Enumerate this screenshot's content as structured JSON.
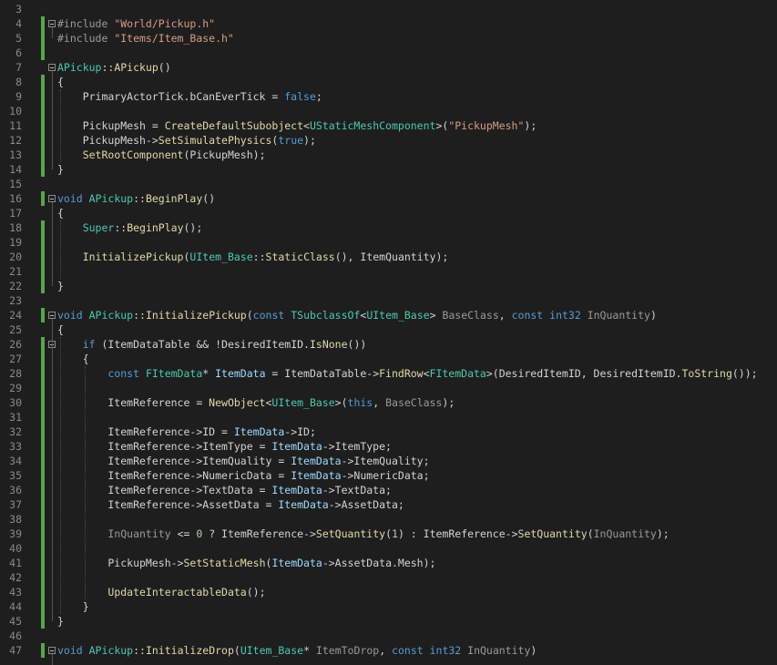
{
  "colors": {
    "background": "#1e1e1e",
    "keyword": "#569cd6",
    "string": "#d69d85",
    "type": "#4ec9b0",
    "function": "#dcdcaa",
    "variable": "#9cdcfe",
    "number": "#b5cea8",
    "change_bar": "#57a64a"
  },
  "lines": [
    {
      "num": "3",
      "tokens": []
    },
    {
      "num": "4",
      "tokens": [
        [
          "pre",
          "#include "
        ],
        [
          "str",
          "\"World/Pickup.h\""
        ]
      ]
    },
    {
      "num": "5",
      "tokens": [
        [
          "pre",
          "#include "
        ],
        [
          "str",
          "\"Items/Item_Base.h\""
        ]
      ]
    },
    {
      "num": "6",
      "tokens": []
    },
    {
      "num": "7",
      "tokens": [
        [
          "cls",
          "APickup"
        ],
        [
          "def",
          "::"
        ],
        [
          "fn",
          "APickup"
        ],
        [
          "def",
          "()"
        ]
      ]
    },
    {
      "num": "8",
      "tokens": [
        [
          "def",
          "{"
        ]
      ]
    },
    {
      "num": "9",
      "tokens": [
        [
          "def",
          "    PrimaryActorTick.bCanEverTick = "
        ],
        [
          "kw",
          "false"
        ],
        [
          "def",
          ";"
        ]
      ]
    },
    {
      "num": "10",
      "tokens": []
    },
    {
      "num": "11",
      "tokens": [
        [
          "def",
          "    PickupMesh = "
        ],
        [
          "fn",
          "CreateDefaultSubobject"
        ],
        [
          "def",
          "<"
        ],
        [
          "cls",
          "UStaticMeshComponent"
        ],
        [
          "def",
          ">("
        ],
        [
          "str",
          "\"PickupMesh\""
        ],
        [
          "def",
          ");"
        ]
      ]
    },
    {
      "num": "12",
      "tokens": [
        [
          "def",
          "    PickupMesh->"
        ],
        [
          "fn",
          "SetSimulatePhysics"
        ],
        [
          "def",
          "("
        ],
        [
          "kw",
          "true"
        ],
        [
          "def",
          ");"
        ]
      ]
    },
    {
      "num": "13",
      "tokens": [
        [
          "def",
          "    "
        ],
        [
          "fn",
          "SetRootComponent"
        ],
        [
          "def",
          "(PickupMesh);"
        ]
      ]
    },
    {
      "num": "14",
      "tokens": [
        [
          "def",
          "}"
        ]
      ]
    },
    {
      "num": "15",
      "tokens": []
    },
    {
      "num": "16",
      "tokens": [
        [
          "kw",
          "void "
        ],
        [
          "cls",
          "APickup"
        ],
        [
          "def",
          "::"
        ],
        [
          "fn",
          "BeginPlay"
        ],
        [
          "def",
          "()"
        ]
      ]
    },
    {
      "num": "17",
      "tokens": [
        [
          "def",
          "{"
        ]
      ]
    },
    {
      "num": "18",
      "tokens": [
        [
          "def",
          "    "
        ],
        [
          "cls",
          "Super"
        ],
        [
          "def",
          "::"
        ],
        [
          "fn",
          "BeginPlay"
        ],
        [
          "def",
          "();"
        ]
      ]
    },
    {
      "num": "19",
      "tokens": []
    },
    {
      "num": "20",
      "tokens": [
        [
          "def",
          "    "
        ],
        [
          "fn",
          "InitializePickup"
        ],
        [
          "def",
          "("
        ],
        [
          "cls",
          "UItem_Base"
        ],
        [
          "def",
          "::"
        ],
        [
          "fn",
          "StaticClass"
        ],
        [
          "def",
          "(), ItemQuantity);"
        ]
      ]
    },
    {
      "num": "21",
      "tokens": []
    },
    {
      "num": "22",
      "tokens": [
        [
          "def",
          "}"
        ]
      ]
    },
    {
      "num": "23",
      "tokens": []
    },
    {
      "num": "24",
      "tokens": [
        [
          "kw",
          "void "
        ],
        [
          "cls",
          "APickup"
        ],
        [
          "def",
          "::"
        ],
        [
          "fn",
          "InitializePickup"
        ],
        [
          "def",
          "("
        ],
        [
          "kw",
          "const "
        ],
        [
          "cls",
          "TSubclassOf"
        ],
        [
          "def",
          "<"
        ],
        [
          "cls",
          "UItem_Base"
        ],
        [
          "def",
          "> "
        ],
        [
          "par",
          "BaseClass"
        ],
        [
          "def",
          ", "
        ],
        [
          "kw",
          "const "
        ],
        [
          "kw",
          "int32 "
        ],
        [
          "par",
          "InQuantity"
        ],
        [
          "def",
          ")"
        ]
      ]
    },
    {
      "num": "25",
      "tokens": [
        [
          "def",
          "{"
        ]
      ]
    },
    {
      "num": "26",
      "tokens": [
        [
          "def",
          "    "
        ],
        [
          "kw",
          "if"
        ],
        [
          "def",
          " (ItemDataTable && !DesiredItemID."
        ],
        [
          "fn",
          "IsNone"
        ],
        [
          "def",
          "())"
        ]
      ]
    },
    {
      "num": "27",
      "tokens": [
        [
          "def",
          "    {"
        ]
      ]
    },
    {
      "num": "28",
      "tokens": [
        [
          "def",
          "        "
        ],
        [
          "kw",
          "const "
        ],
        [
          "cls",
          "FItemData"
        ],
        [
          "def",
          "* "
        ],
        [
          "var",
          "ItemData"
        ],
        [
          "def",
          " = ItemDataTable->"
        ],
        [
          "fn",
          "FindRow"
        ],
        [
          "def",
          "<"
        ],
        [
          "cls",
          "FItemData"
        ],
        [
          "def",
          ">(DesiredItemID, DesiredItemID."
        ],
        [
          "fn",
          "ToString"
        ],
        [
          "def",
          "());"
        ]
      ]
    },
    {
      "num": "29",
      "tokens": []
    },
    {
      "num": "30",
      "tokens": [
        [
          "def",
          "        ItemReference = "
        ],
        [
          "fn",
          "NewObject"
        ],
        [
          "def",
          "<"
        ],
        [
          "cls",
          "UItem_Base"
        ],
        [
          "def",
          ">("
        ],
        [
          "kw",
          "this"
        ],
        [
          "def",
          ", "
        ],
        [
          "par",
          "BaseClass"
        ],
        [
          "def",
          ");"
        ]
      ]
    },
    {
      "num": "31",
      "tokens": []
    },
    {
      "num": "32",
      "tokens": [
        [
          "def",
          "        ItemReference->ID = "
        ],
        [
          "var",
          "ItemData"
        ],
        [
          "def",
          "->ID;"
        ]
      ]
    },
    {
      "num": "33",
      "tokens": [
        [
          "def",
          "        ItemReference->ItemType = "
        ],
        [
          "var",
          "ItemData"
        ],
        [
          "def",
          "->ItemType;"
        ]
      ]
    },
    {
      "num": "34",
      "tokens": [
        [
          "def",
          "        ItemReference->ItemQuality = "
        ],
        [
          "var",
          "ItemData"
        ],
        [
          "def",
          "->ItemQuality;"
        ]
      ]
    },
    {
      "num": "35",
      "tokens": [
        [
          "def",
          "        ItemReference->NumericData = "
        ],
        [
          "var",
          "ItemData"
        ],
        [
          "def",
          "->NumericData;"
        ]
      ]
    },
    {
      "num": "36",
      "tokens": [
        [
          "def",
          "        ItemReference->TextData = "
        ],
        [
          "var",
          "ItemData"
        ],
        [
          "def",
          "->TextData;"
        ]
      ]
    },
    {
      "num": "37",
      "tokens": [
        [
          "def",
          "        ItemReference->AssetData = "
        ],
        [
          "var",
          "ItemData"
        ],
        [
          "def",
          "->AssetData;"
        ]
      ]
    },
    {
      "num": "38",
      "tokens": []
    },
    {
      "num": "39",
      "tokens": [
        [
          "def",
          "        "
        ],
        [
          "par",
          "InQuantity"
        ],
        [
          "def",
          " <= "
        ],
        [
          "num",
          "0"
        ],
        [
          "def",
          " ? ItemReference->"
        ],
        [
          "fn",
          "SetQuantity"
        ],
        [
          "def",
          "("
        ],
        [
          "num",
          "1"
        ],
        [
          "def",
          ") : ItemReference->"
        ],
        [
          "fn",
          "SetQuantity"
        ],
        [
          "def",
          "("
        ],
        [
          "par",
          "InQuantity"
        ],
        [
          "def",
          ");"
        ]
      ]
    },
    {
      "num": "40",
      "tokens": []
    },
    {
      "num": "41",
      "tokens": [
        [
          "def",
          "        PickupMesh->"
        ],
        [
          "fn",
          "SetStaticMesh"
        ],
        [
          "def",
          "("
        ],
        [
          "var",
          "ItemData"
        ],
        [
          "def",
          "->AssetData.Mesh);"
        ]
      ]
    },
    {
      "num": "42",
      "tokens": []
    },
    {
      "num": "43",
      "tokens": [
        [
          "def",
          "        "
        ],
        [
          "fn",
          "UpdateInteractableData"
        ],
        [
          "def",
          "();"
        ]
      ]
    },
    {
      "num": "44",
      "tokens": [
        [
          "def",
          "    }"
        ]
      ]
    },
    {
      "num": "45",
      "tokens": [
        [
          "def",
          "}"
        ]
      ]
    },
    {
      "num": "46",
      "tokens": []
    },
    {
      "num": "47",
      "tokens": [
        [
          "kw",
          "void "
        ],
        [
          "cls",
          "APickup"
        ],
        [
          "def",
          "::"
        ],
        [
          "fn",
          "InitializeDrop"
        ],
        [
          "def",
          "("
        ],
        [
          "cls",
          "UItem_Base"
        ],
        [
          "def",
          "* "
        ],
        [
          "par",
          "ItemToDrop"
        ],
        [
          "def",
          ", "
        ],
        [
          "kw",
          "const "
        ],
        [
          "kw",
          "int32 "
        ],
        [
          "par",
          "InQuantity"
        ],
        [
          "def",
          ")"
        ]
      ]
    }
  ]
}
